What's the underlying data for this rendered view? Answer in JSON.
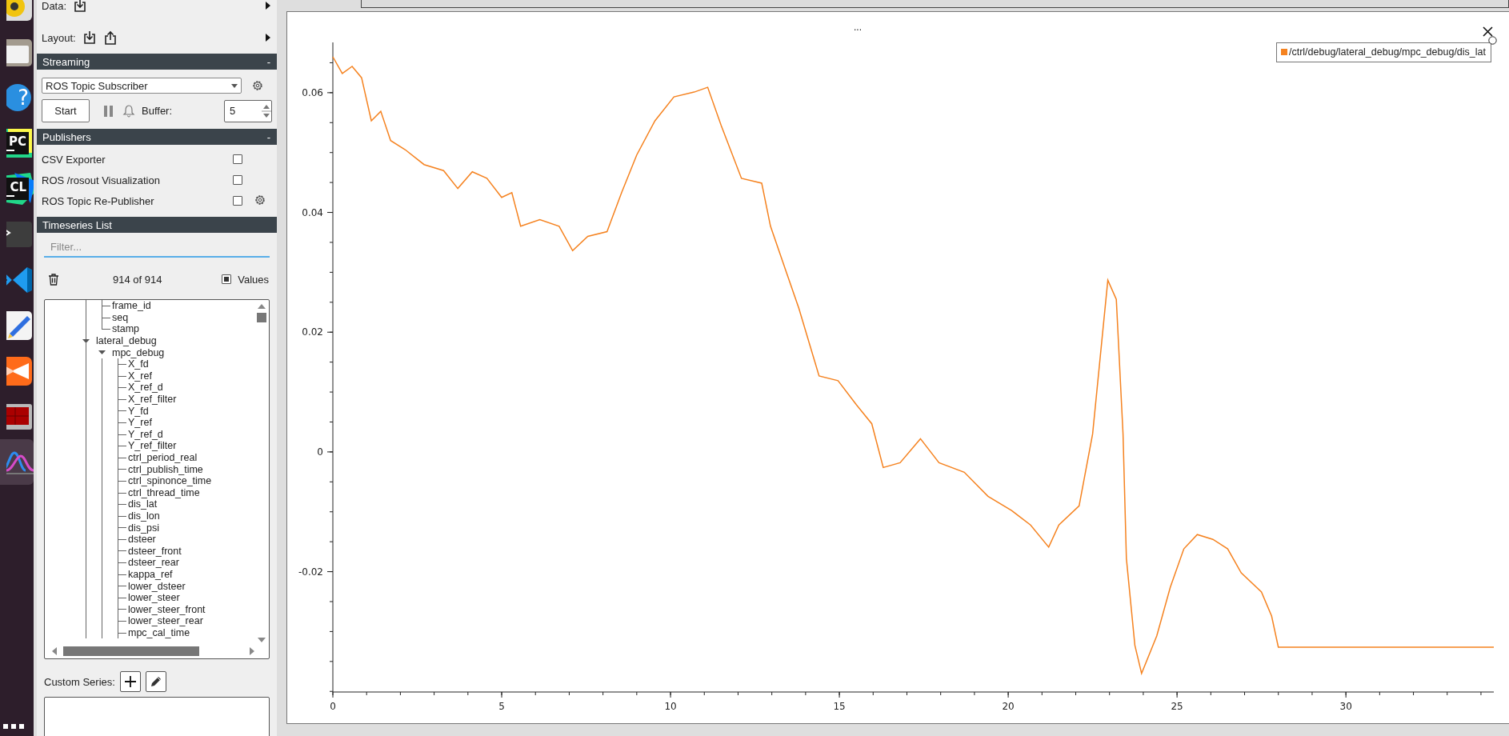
{
  "dock": {
    "apps": [
      {
        "kind": "speaker",
        "selected": false
      },
      {
        "kind": "files",
        "selected": false
      },
      {
        "kind": "help",
        "text": "?",
        "selected": false
      },
      {
        "kind": "pycharm",
        "text": "PC",
        "selected": false
      },
      {
        "kind": "clion",
        "text": "CL",
        "selected": false
      },
      {
        "kind": "terminal",
        "selected": false
      },
      {
        "kind": "vscode",
        "selected": false
      },
      {
        "kind": "editor",
        "selected": false
      },
      {
        "kind": "video",
        "selected": false
      },
      {
        "kind": "terminator",
        "selected": false
      },
      {
        "kind": "plotjuggler",
        "selected": true
      }
    ]
  },
  "sidebar": {
    "data_label": "Data:",
    "layout_label": "Layout:",
    "streaming": {
      "title": "Streaming",
      "collapse": "-",
      "source": "ROS Topic Subscriber",
      "start": "Start",
      "buffer_label": "Buffer:",
      "buffer": "5"
    },
    "publishers": {
      "title": "Publishers",
      "collapse": "-",
      "items": [
        {
          "label": "CSV Exporter",
          "checked": false,
          "settings": false
        },
        {
          "label": "ROS /rosout Visualization",
          "checked": false,
          "settings": false
        },
        {
          "label": "ROS Topic Re-Publisher",
          "checked": false,
          "settings": true
        }
      ]
    },
    "timeseries": {
      "title": "Timeseries List",
      "filter_placeholder": "Filter...",
      "count": "914 of 914",
      "values_label": "Values",
      "values_checked": true,
      "tree": [
        {
          "children": [
            {
              "label": "frame_id"
            },
            {
              "label": "seq"
            },
            {
              "label": "stamp"
            }
          ]
        },
        {
          "label": "lateral_debug",
          "expanded": true,
          "children": [
            {
              "label": "mpc_debug",
              "expanded": true,
              "children": [
                {
                  "label": "X_fd"
                },
                {
                  "label": "X_ref"
                },
                {
                  "label": "X_ref_d"
                },
                {
                  "label": "X_ref_filter"
                },
                {
                  "label": "Y_fd"
                },
                {
                  "label": "Y_ref"
                },
                {
                  "label": "Y_ref_d"
                },
                {
                  "label": "Y_ref_filter"
                },
                {
                  "label": "ctrl_period_real"
                },
                {
                  "label": "ctrl_publish_time"
                },
                {
                  "label": "ctrl_spinonce_time"
                },
                {
                  "label": "ctrl_thread_time"
                },
                {
                  "label": "dis_lat"
                },
                {
                  "label": "dis_lon"
                },
                {
                  "label": "dis_psi"
                },
                {
                  "label": "dsteer"
                },
                {
                  "label": "dsteer_front"
                },
                {
                  "label": "dsteer_rear"
                },
                {
                  "label": "kappa_ref"
                },
                {
                  "label": "lower_dsteer"
                },
                {
                  "label": "lower_steer"
                },
                {
                  "label": "lower_steer_front"
                },
                {
                  "label": "lower_steer_rear"
                },
                {
                  "label": "mpc_cal_time"
                }
              ]
            }
          ]
        }
      ]
    },
    "custom_series_label": "Custom Series:"
  },
  "plot": {
    "title": "...",
    "chart_data": {
      "type": "line",
      "xlim": [
        0,
        34.38
      ],
      "ylim": [
        -0.0401,
        0.0684
      ],
      "xticks": [
        0,
        5,
        10,
        15,
        20,
        25,
        30
      ],
      "yticks": [
        -0.02,
        0,
        0.02,
        0.04,
        0.06
      ],
      "x": [
        0,
        0.28,
        0.57,
        0.85,
        1.14,
        1.42,
        1.71,
        2.14,
        2.7,
        3.28,
        3.7,
        4.13,
        4.56,
        5.0,
        5.3,
        5.56,
        6.13,
        6.7,
        7.1,
        7.55,
        8.12,
        8.55,
        9.0,
        9.54,
        10.1,
        10.7,
        11.1,
        11.5,
        12.1,
        12.7,
        12.96,
        13.4,
        13.8,
        14.4,
        14.96,
        15.5,
        15.96,
        16.3,
        16.8,
        17.4,
        17.95,
        18.7,
        19.4,
        20.1,
        20.66,
        21.2,
        21.5,
        22.1,
        22.5,
        22.95,
        23.2,
        23.4,
        23.5,
        23.75,
        23.95,
        24.4,
        24.8,
        25.2,
        25.6,
        26.06,
        26.5,
        26.9,
        27.5,
        27.8,
        28.0,
        34.38
      ],
      "series": [
        {
          "name": "/ctrl/debug/lateral_debug/mpc_debug/dis_lat",
          "color": "#f5821f",
          "values": [
            0.066,
            0.0632,
            0.0644,
            0.0625,
            0.0553,
            0.0569,
            0.052,
            0.0505,
            0.048,
            0.047,
            0.044,
            0.0468,
            0.0457,
            0.0425,
            0.0433,
            0.0377,
            0.0388,
            0.0377,
            0.0336,
            0.036,
            0.0368,
            0.0433,
            0.0496,
            0.0553,
            0.0593,
            0.0601,
            0.0609,
            0.0545,
            0.0457,
            0.0449,
            0.0377,
            0.0305,
            0.024,
            0.0127,
            0.0119,
            0.0079,
            0.0047,
            -0.0026,
            -0.0018,
            0.0022,
            -0.0018,
            -0.0034,
            -0.0074,
            -0.0098,
            -0.0122,
            -0.0159,
            -0.0122,
            -0.009,
            0.003,
            0.0287,
            0.0255,
            0.003,
            -0.0178,
            -0.0323,
            -0.037,
            -0.0307,
            -0.0226,
            -0.0162,
            -0.0138,
            -0.0146,
            -0.0162,
            -0.0202,
            -0.0234,
            -0.0274,
            -0.0326,
            -0.0326
          ]
        }
      ]
    }
  }
}
